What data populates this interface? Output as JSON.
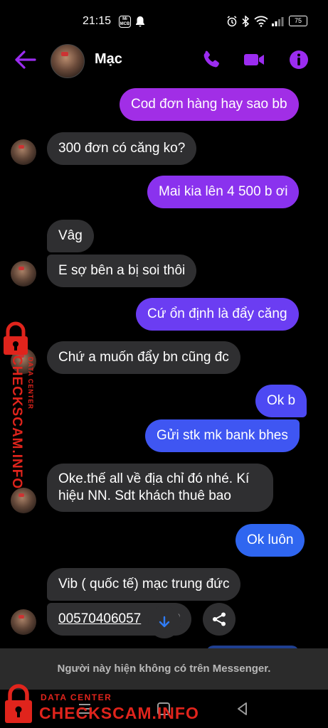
{
  "status_bar": {
    "time": "21:15",
    "mi_badge": "Mi\nMCB",
    "battery": "75"
  },
  "header": {
    "contact_name": "Mạc",
    "accent_color": "#9b2cf0"
  },
  "messages": [
    {
      "direction": "out",
      "text": "Cod đơn hàng hay sao bb"
    },
    {
      "direction": "in",
      "text": "300 đơn có căng ko?"
    },
    {
      "direction": "out",
      "text": "Mai kia lên 4 500 b ơi"
    },
    {
      "direction": "in",
      "text": "Vâg"
    },
    {
      "direction": "in",
      "text": "E sợ bên a bị soi thôi"
    },
    {
      "direction": "out",
      "text": "Cứ ổn định là đẩy căng"
    },
    {
      "direction": "in",
      "text": "Chứ a muốn đẩy bn cũng đc"
    },
    {
      "direction": "out",
      "text": "Ok b"
    },
    {
      "direction": "out",
      "text": "Gửi stk mk bank bhes"
    },
    {
      "direction": "in",
      "text": "Oke.thế all về địa chỉ đó nhé. Kí hiệu NN. Sdt khách thuê bao",
      "lines": [
        "Oke.thế all về địa chỉ đó nhé. Kí",
        "hiệu NN. Sdt khách thuê bao"
      ]
    },
    {
      "direction": "out",
      "text": "Ok luôn"
    },
    {
      "direction": "in",
      "text": "Vib ( quốc tế) mạc trung đức"
    },
    {
      "direction": "in",
      "text": "00570406057",
      "tail": "0",
      "is_link": true
    }
  ],
  "footer": {
    "unavailable_notice": "Người này hiện không có trên Messenger."
  },
  "watermarks": {
    "side_text": "CHECKSCAM.INFO",
    "side_sub": "DATA CENTER",
    "bottom_sub": "DATA CENTER",
    "bottom_text": "CHECKSCAM.INFO",
    "color": "#e0241c"
  }
}
